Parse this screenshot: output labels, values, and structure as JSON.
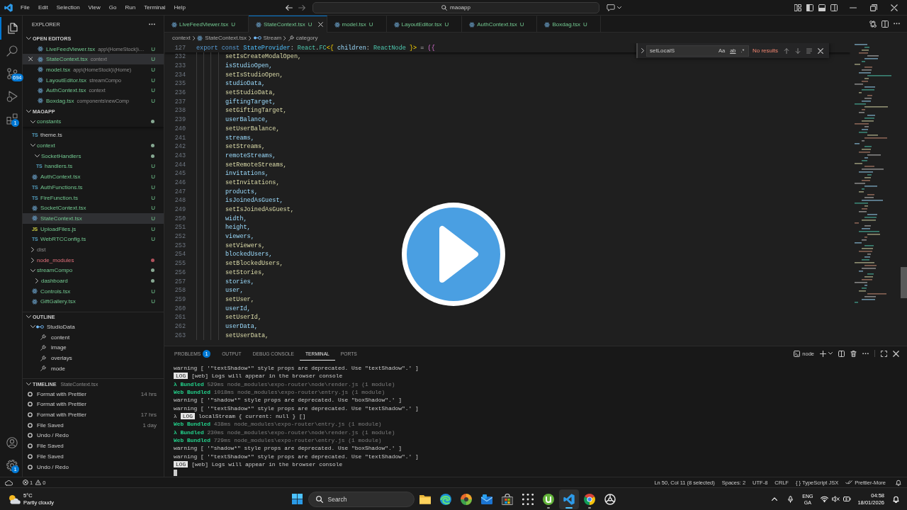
{
  "title_bar": {
    "menu": [
      "File",
      "Edit",
      "Selection",
      "View",
      "Go",
      "Run",
      "Terminal",
      "Help"
    ],
    "search": {
      "label": "maoapp"
    }
  },
  "activity_bar": {
    "items": [
      {
        "kind": "explorer",
        "selected": true
      },
      {
        "kind": "search",
        "selected": false
      },
      {
        "kind": "source-control",
        "selected": false,
        "badge": "694"
      },
      {
        "kind": "run",
        "selected": false
      },
      {
        "kind": "extensions",
        "selected": false,
        "badge": "1"
      }
    ],
    "bottom": [
      {
        "kind": "account"
      },
      {
        "kind": "settings",
        "badge": "1"
      }
    ]
  },
  "sidebar": {
    "title": "EXPLORER",
    "open_editors": {
      "title": "OPEN EDITORS",
      "expanded": true,
      "items": [
        {
          "label": "LiveFeedViewer.tsx",
          "path": "app\\(HomeStock)\\…",
          "badge": "U",
          "untracked": true,
          "selected": false
        },
        {
          "label": "StateContext.tsx",
          "path": "context",
          "badge": "U",
          "untracked": true,
          "selected": true
        },
        {
          "label": "model.tsx",
          "path": "app\\(HomeStock)\\(Home)",
          "badge": "U",
          "untracked": true,
          "selected": false
        },
        {
          "label": "LayoutEditor.tsx",
          "path": "streamCompo",
          "badge": "U",
          "untracked": true,
          "selected": false
        },
        {
          "label": "AuthContext.tsx",
          "path": "context",
          "badge": "U",
          "untracked": true,
          "selected": false
        },
        {
          "label": "Boxdag.tsx",
          "path": "components\\newComp",
          "badge": "U",
          "untracked": true,
          "selected": false
        }
      ]
    },
    "folder": {
      "title": "MAOAPP",
      "expanded": true,
      "items": [
        {
          "label": "constants",
          "kind": "folder",
          "untracked": true,
          "ignored": false,
          "has_errors": false,
          "expanded": true,
          "dot": true,
          "selected": false,
          "children": [
            {
              "label": "theme.ts",
              "kind": "ts",
              "type_label": "TS",
              "untracked": false,
              "ignored": false,
              "has_errors": false,
              "selected": false
            }
          ]
        },
        {
          "label": "context",
          "kind": "folder",
          "untracked": true,
          "ignored": false,
          "has_errors": false,
          "expanded": true,
          "dot": true,
          "selected": false,
          "children": [
            {
              "label": "SocketHandlers",
              "kind": "folder",
              "untracked": true,
              "ignored": false,
              "has_errors": false,
              "expanded": true,
              "dot": true,
              "selected": false,
              "children": [
                {
                  "label": "handlers.ts",
                  "kind": "ts",
                  "type_label": "TS",
                  "untracked": true,
                  "ignored": false,
                  "has_errors": false,
                  "badge": "U",
                  "selected": false
                }
              ]
            },
            {
              "label": "AuthContext.tsx",
              "kind": "react",
              "untracked": true,
              "ignored": false,
              "has_errors": false,
              "badge": "U",
              "selected": false
            },
            {
              "label": "AuthFunctions.ts",
              "kind": "ts",
              "type_label": "TS",
              "untracked": true,
              "ignored": false,
              "has_errors": false,
              "badge": "U",
              "selected": false
            },
            {
              "label": "FireFunction.ts",
              "kind": "ts",
              "type_label": "TS",
              "untracked": true,
              "ignored": false,
              "has_errors": false,
              "badge": "U",
              "selected": false
            },
            {
              "label": "SocketContext.tsx",
              "kind": "react",
              "untracked": true,
              "ignored": false,
              "has_errors": false,
              "badge": "U",
              "selected": false
            },
            {
              "label": "StateContext.tsx",
              "kind": "react",
              "untracked": true,
              "ignored": false,
              "has_errors": false,
              "badge": "U",
              "selected": true
            },
            {
              "label": "UploadFiles.js",
              "kind": "js",
              "type_label": "JS",
              "untracked": true,
              "ignored": false,
              "has_errors": false,
              "badge": "U",
              "selected": false
            },
            {
              "label": "WebRTCConfig.ts",
              "kind": "ts",
              "type_label": "TS",
              "untracked": true,
              "ignored": false,
              "has_errors": false,
              "badge": "U",
              "selected": false
            }
          ]
        },
        {
          "label": "dist",
          "kind": "folder",
          "untracked": false,
          "ignored": true,
          "has_errors": false,
          "expanded": false,
          "dot": false,
          "selected": false
        },
        {
          "label": "node_modules",
          "kind": "folder",
          "untracked": false,
          "ignored": false,
          "has_errors": true,
          "expanded": false,
          "dot": true,
          "selected": false
        },
        {
          "label": "streamCompo",
          "kind": "folder",
          "untracked": true,
          "ignored": false,
          "has_errors": false,
          "expanded": true,
          "dot": true,
          "selected": false,
          "children": [
            {
              "label": "dashboard",
              "kind": "folder",
              "untracked": true,
              "ignored": false,
              "has_errors": false,
              "expanded": false,
              "dot": true,
              "selected": false
            },
            {
              "label": "Controls.tsx",
              "kind": "react",
              "untracked": true,
              "ignored": false,
              "has_errors": false,
              "badge": "U",
              "selected": false
            },
            {
              "label": "GiftGallery.tsx",
              "kind": "react",
              "untracked": true,
              "ignored": false,
              "has_errors": false,
              "badge": "U",
              "selected": false
            }
          ]
        }
      ]
    },
    "outline": {
      "title": "OUTLINE",
      "expanded": true,
      "items": [
        {
          "label": "StudioData",
          "kind": "variable",
          "expanded": true,
          "selected": false,
          "children": [
            {
              "label": "content",
              "kind": "property",
              "selected": false
            },
            {
              "label": "image",
              "kind": "property",
              "selected": false
            },
            {
              "label": "overlays",
              "kind": "property",
              "selected": false
            },
            {
              "label": "mode",
              "kind": "property",
              "selected": false
            }
          ]
        }
      ]
    },
    "timeline": {
      "title": "TIMELINE",
      "file": "StateContext.tsx",
      "expanded": true,
      "items": [
        {
          "label": "Format with Prettier",
          "time": "14 hrs",
          "selected": false
        },
        {
          "label": "Format with Prettier",
          "selected": false
        },
        {
          "label": "Format with Prettier",
          "time": "17 hrs",
          "selected": false
        },
        {
          "label": "File Saved",
          "time": "1 day",
          "selected": false
        },
        {
          "label": "Undo / Redo",
          "selected": false
        },
        {
          "label": "File Saved",
          "selected": false
        },
        {
          "label": "File Saved",
          "selected": false
        },
        {
          "label": "Undo / Redo",
          "selected": false
        }
      ]
    }
  },
  "editor": {
    "tabs": [
      {
        "label": "LiveFeedViewer.tsx",
        "badge": "U",
        "untracked": true,
        "selected": false
      },
      {
        "label": "StateContext.tsx",
        "badge": "U",
        "untracked": true,
        "selected": true
      },
      {
        "label": "model.tsx",
        "badge": "U",
        "untracked": true,
        "selected": false
      },
      {
        "label": "LayoutEditor.tsx",
        "badge": "U",
        "untracked": true,
        "selected": false
      },
      {
        "label": "AuthContext.tsx",
        "badge": "U",
        "untracked": true,
        "selected": false
      },
      {
        "label": "Boxdag.tsx",
        "badge": "U",
        "untracked": true,
        "selected": false
      }
    ],
    "breadcrumb": [
      {
        "label": "context",
        "kind": "folder"
      },
      {
        "label": "StateContext.tsx",
        "kind": "react"
      },
      {
        "label": "Stream",
        "kind": "variable"
      },
      {
        "label": "category",
        "kind": "property"
      }
    ],
    "sticky_line": {
      "number": "127",
      "tokens": [
        {
          "text": "export const ",
          "kind": "keyword"
        },
        {
          "text": "StateProvider",
          "kind": "constant"
        },
        {
          "text": ": ",
          "kind": "plain"
        },
        {
          "text": "React",
          "kind": "type"
        },
        {
          "text": ".",
          "kind": "plain"
        },
        {
          "text": "FC",
          "kind": "type"
        },
        {
          "text": "<{ ",
          "kind": "bracket"
        },
        {
          "text": "children",
          "kind": "variable"
        },
        {
          "text": ": ",
          "kind": "plain"
        },
        {
          "text": "ReactNode",
          "kind": "type"
        },
        {
          "text": " }>",
          "kind": "bracket"
        },
        {
          "text": " = ",
          "kind": "plain"
        },
        {
          "text": "({",
          "kind": "bracket2"
        }
      ]
    },
    "lines": [
      {
        "number": "232",
        "text": "setIsCreateModalOpen,",
        "kind": "function"
      },
      {
        "number": "233",
        "text": "isStudioOpen,",
        "kind": "variable"
      },
      {
        "number": "234",
        "text": "setIsStudioOpen,",
        "kind": "function"
      },
      {
        "number": "235",
        "text": "studioData,",
        "kind": "variable"
      },
      {
        "number": "236",
        "text": "setStudioData,",
        "kind": "function"
      },
      {
        "number": "237",
        "text": "giftingTarget,",
        "kind": "variable"
      },
      {
        "number": "238",
        "text": "setGiftingTarget,",
        "kind": "function"
      },
      {
        "number": "239",
        "text": "userBalance,",
        "kind": "variable"
      },
      {
        "number": "240",
        "text": "setUserBalance,",
        "kind": "function"
      },
      {
        "number": "241",
        "text": "streams,",
        "kind": "variable"
      },
      {
        "number": "242",
        "text": "setStreams,",
        "kind": "function"
      },
      {
        "number": "243",
        "text": "remoteStreams,",
        "kind": "variable"
      },
      {
        "number": "244",
        "text": "setRemoteStreams,",
        "kind": "function"
      },
      {
        "number": "245",
        "text": "invitations,",
        "kind": "variable"
      },
      {
        "number": "246",
        "text": "setInvitations,",
        "kind": "function"
      },
      {
        "number": "247",
        "text": "products,",
        "kind": "variable"
      },
      {
        "number": "248",
        "text": "isJoinedAsGuest,",
        "kind": "variable"
      },
      {
        "number": "249",
        "text": "setIsJoinedAsGuest,",
        "kind": "function"
      },
      {
        "number": "250",
        "text": "width,",
        "kind": "variable"
      },
      {
        "number": "251",
        "text": "height,",
        "kind": "variable"
      },
      {
        "number": "252",
        "text": "viewers,",
        "kind": "variable"
      },
      {
        "number": "253",
        "text": "setViewers,",
        "kind": "function"
      },
      {
        "number": "254",
        "text": "blockedUsers,",
        "kind": "variable"
      },
      {
        "number": "255",
        "text": "setBlockedUsers,",
        "kind": "function"
      },
      {
        "number": "256",
        "text": "setStories,",
        "kind": "function"
      },
      {
        "number": "257",
        "text": "stories,",
        "kind": "variable"
      },
      {
        "number": "258",
        "text": "user,",
        "kind": "variable"
      },
      {
        "number": "259",
        "text": "setUser,",
        "kind": "function"
      },
      {
        "number": "260",
        "text": "userId,",
        "kind": "variable"
      },
      {
        "number": "261",
        "text": "setUserId,",
        "kind": "function"
      },
      {
        "number": "262",
        "text": "userData,",
        "kind": "variable"
      },
      {
        "number": "263",
        "text": "setUserData,",
        "kind": "function"
      }
    ],
    "find": {
      "value": "setLocalS",
      "options": [
        {
          "label": "Aa",
          "kind": "case",
          "on": false
        },
        {
          "label": "ab",
          "kind": "word",
          "on": false
        },
        {
          "label": ".*",
          "kind": "regex",
          "on": false
        }
      ],
      "result": "No results"
    }
  },
  "panel": {
    "tabs": [
      {
        "label": "PROBLEMS",
        "badge": "1",
        "selected": false
      },
      {
        "label": "OUTPUT",
        "selected": false
      },
      {
        "label": "DEBUG CONSOLE",
        "selected": false
      },
      {
        "label": "TERMINAL",
        "selected": true
      },
      {
        "label": "PORTS",
        "selected": false
      }
    ],
    "terminal_name": "node",
    "lines": [
      {
        "kind": "plain",
        "text": "warning [ '\"textShadow*\" style props are deprecated. Use \"textShadow\".' ]"
      },
      {
        "kind": "log",
        "badge": "LOG",
        "text": "[web] Logs will appear in the browser console"
      },
      {
        "kind": "bundle",
        "label": "λ Bundled",
        "text": "529ms node_modules\\expo-router\\node\\render.js (1 module)"
      },
      {
        "kind": "bundle",
        "label": "Web Bundled",
        "text": "1018ms node_modules\\expo-router\\entry.js (1 module)"
      },
      {
        "kind": "plain",
        "text": "warning [ '\"shadow*\" style props are deprecated. Use \"boxShadow\".' ]"
      },
      {
        "kind": "plain",
        "text": "warning [ '\"textShadow*\" style props are deprecated. Use \"textShadow\".' ]"
      },
      {
        "kind": "log",
        "prefix": "λ",
        "badge": "LOG",
        "text": "localStream { current: null } []"
      },
      {
        "kind": "bundle",
        "label": "Web Bundled",
        "text": "438ms node_modules\\expo-router\\entry.js (1 module)"
      },
      {
        "kind": "bundle",
        "label": "λ Bundled",
        "text": "230ms node_modules\\expo-router\\node\\render.js (1 module)"
      },
      {
        "kind": "bundle",
        "label": "Web Bundled",
        "text": "729ms node_modules\\expo-router\\entry.js (1 module)"
      },
      {
        "kind": "plain",
        "text": "warning [ '\"shadow*\" style props are deprecated. Use \"boxShadow\".' ]"
      },
      {
        "kind": "plain",
        "text": "warning [ '\"textShadow*\" style props are deprecated. Use \"textShadow\".' ]"
      },
      {
        "kind": "log",
        "badge": "LOG",
        "text": "[web] Logs will appear in the browser console"
      }
    ]
  },
  "status_bar": {
    "errors": "1",
    "warnings": "0",
    "items": [
      {
        "kind": "text",
        "text": "Ln 50, Col 11 (8 selected)"
      },
      {
        "kind": "text",
        "text": "Spaces: 2"
      },
      {
        "kind": "text",
        "text": "UTF-8"
      },
      {
        "kind": "text",
        "text": "CRLF"
      },
      {
        "kind": "language",
        "icon_text": "{ }",
        "text": "TypeScript JSX"
      },
      {
        "kind": "formatter",
        "text": "Prettier-More"
      }
    ]
  },
  "taskbar": {
    "weather": {
      "temperature": "5°C",
      "condition": "Partly cloudy"
    },
    "search": {
      "placeholder": "Search"
    },
    "apps": [
      {
        "kind": "folder",
        "running": false,
        "selected": false
      },
      {
        "kind": "wave",
        "running": false,
        "selected": false
      },
      {
        "kind": "swirl",
        "running": false,
        "selected": false
      },
      {
        "kind": "mail",
        "running": false,
        "selected": false
      },
      {
        "kind": "store",
        "running": false,
        "selected": false
      },
      {
        "kind": "grid",
        "running": false,
        "selected": false
      },
      {
        "kind": "torrent",
        "running": true,
        "selected": false
      },
      {
        "kind": "code",
        "running": true,
        "selected": true
      },
      {
        "kind": "tricolor",
        "running": true,
        "selected": false
      },
      {
        "kind": "ring",
        "running": false,
        "selected": false
      }
    ],
    "language": {
      "code": "ENG",
      "layout": "GA"
    },
    "clock": {
      "time": "04:58",
      "date": "18/01/2026"
    }
  }
}
